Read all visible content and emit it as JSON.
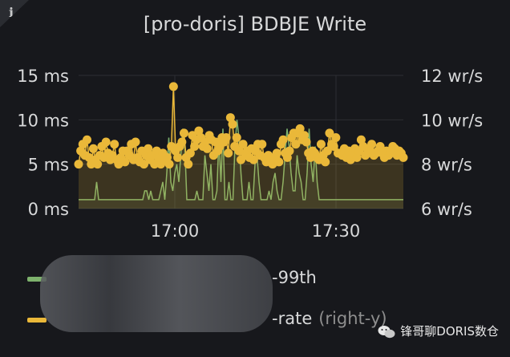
{
  "panel": {
    "title": "[pro-doris] BDBJE Write",
    "info_icon": "i"
  },
  "legend": [
    {
      "label": "-99th",
      "suffix": "",
      "color": "#7eb26d",
      "icon": "legend-line-swatch"
    },
    {
      "label": "-rate",
      "suffix": "(right-y)",
      "color": "#eab839",
      "icon": "legend-line-swatch"
    }
  ],
  "watermark": {
    "text": "锋哥聊DORIS数仓",
    "icon": "wechat-icon"
  },
  "chart_data": {
    "type": "line",
    "title": "[pro-doris] BDBJE Write",
    "x_ticks": [
      "17:00",
      "17:30"
    ],
    "y_left": {
      "ticks": [
        "0 ms",
        "5 ms",
        "10 ms",
        "15 ms"
      ],
      "range": [
        0,
        15
      ]
    },
    "y_right": {
      "ticks": [
        "6 wr/s",
        "8 wr/s",
        "10 wr/s",
        "12 wr/s"
      ],
      "range": [
        6,
        12
      ]
    },
    "grid": true,
    "legend_position": "bottom",
    "series": [
      {
        "name": "-99th",
        "axis": "left",
        "color": "#7eb26d",
        "values": [
          1,
          1,
          1,
          1,
          1,
          1,
          1,
          1,
          1,
          3,
          1,
          1,
          1,
          1,
          1,
          1,
          1,
          1,
          1,
          1,
          1,
          1,
          1,
          1,
          1,
          1,
          1,
          1,
          1,
          1,
          1,
          1,
          1,
          2,
          2,
          1,
          2,
          1,
          1,
          1,
          1,
          2,
          3,
          1,
          4,
          8,
          3,
          2,
          4,
          5,
          3,
          6,
          9,
          7,
          1,
          1,
          1,
          1,
          1,
          2,
          1,
          1,
          1,
          6,
          4,
          2,
          5,
          1,
          1,
          2,
          8,
          3,
          9,
          1,
          1,
          3,
          1,
          1,
          7,
          10,
          8,
          4,
          1,
          1,
          1,
          3,
          1,
          1,
          5,
          6,
          3,
          1,
          1,
          1,
          1,
          2,
          1,
          3,
          4,
          2,
          1,
          1,
          3,
          6,
          9,
          7,
          4,
          2,
          2,
          6,
          4,
          3,
          1,
          1,
          4,
          9,
          5,
          3,
          7,
          3,
          1,
          1,
          1,
          1,
          1,
          1,
          1,
          1,
          1,
          1,
          1,
          1,
          1,
          1,
          1,
          1,
          1,
          1,
          1,
          1,
          1,
          1,
          1,
          1,
          1,
          1,
          1,
          1,
          1,
          1,
          1,
          1,
          1,
          1,
          1,
          1,
          1,
          1,
          1,
          1,
          1,
          1,
          1
        ]
      },
      {
        "name": "-rate",
        "axis": "right",
        "color": "#eab839",
        "values": [
          8.0,
          8.6,
          8.9,
          8.4,
          9.1,
          8.3,
          8.0,
          8.7,
          8.2,
          8.0,
          8.4,
          8.8,
          8.3,
          9.0,
          8.5,
          8.2,
          8.4,
          8.9,
          8.2,
          8.0,
          8.3,
          8.6,
          8.1,
          8.6,
          8.4,
          8.9,
          8.2,
          9.0,
          8.3,
          8.1,
          8.6,
          8.0,
          8.4,
          8.7,
          8.2,
          8.4,
          8.0,
          8.6,
          8.3,
          8.0,
          8.5,
          8.2,
          8.3,
          8.0,
          8.8,
          11.5,
          8.6,
          8.3,
          8.8,
          9.0,
          9.4,
          8.3,
          8.0,
          8.5,
          9.3,
          8.8,
          9.1,
          9.5,
          9.2,
          8.8,
          9.0,
          8.7,
          9.3,
          9.1,
          8.4,
          9.0,
          8.6,
          8.8,
          9.2,
          9.0,
          9.2,
          8.5,
          10.1,
          9.8,
          8.8,
          9.2,
          8.6,
          8.2,
          8.9,
          8.4,
          8.6,
          8.3,
          8.7,
          8.2,
          8.6,
          8.9,
          8.4,
          8.9,
          8.3,
          8.1,
          8.4,
          8.2,
          8.0,
          8.3,
          8.5,
          8.1,
          8.9,
          9.1,
          8.5,
          8.3,
          8.6,
          9.2,
          9.4,
          8.9,
          9.4,
          9.6,
          9.1,
          9.3,
          9.0,
          8.5,
          8.3,
          8.6,
          8.5,
          8.3,
          8.2,
          8.9,
          8.4,
          8.1,
          8.6,
          9.4,
          8.9,
          8.8,
          9.2,
          8.5,
          8.5,
          8.4,
          8.7,
          8.3,
          8.6,
          8.2,
          8.5,
          8.7,
          8.3,
          8.6,
          9.1,
          8.8,
          8.4,
          8.5,
          8.7,
          8.9,
          8.4,
          8.5,
          8.6,
          8.8,
          8.5,
          8.3,
          8.6,
          8.4,
          8.5,
          8.8,
          8.7,
          8.4,
          8.6,
          8.5,
          8.3
        ]
      }
    ]
  }
}
